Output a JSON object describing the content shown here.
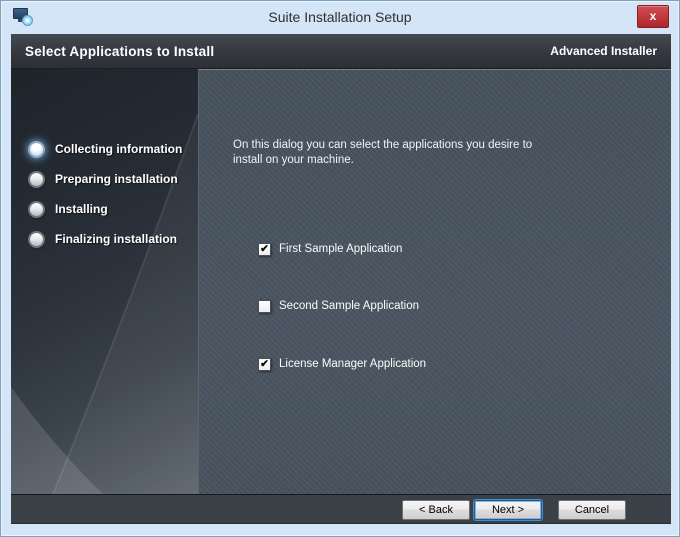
{
  "window": {
    "title": "Suite Installation Setup"
  },
  "icons": {
    "app": "installer-monitor-disc",
    "close": "x",
    "check": "✔"
  },
  "header": {
    "title": "Select Applications to Install",
    "brand": "Advanced Installer"
  },
  "sidebar": {
    "steps": [
      {
        "label": "Collecting information",
        "active": true
      },
      {
        "label": "Preparing installation",
        "active": false
      },
      {
        "label": "Installing",
        "active": false
      },
      {
        "label": "Finalizing installation",
        "active": false
      }
    ]
  },
  "main": {
    "description_lines": [
      "On this dialog you can select the applications you desire to",
      "install on your machine."
    ],
    "checkboxes": [
      {
        "label": "First Sample Application",
        "checked": true
      },
      {
        "label": "Second Sample Application",
        "checked": false
      },
      {
        "label": "License Manager Application",
        "checked": true
      }
    ]
  },
  "footer": {
    "buttons": [
      {
        "label": "< Back",
        "focused": false
      },
      {
        "label": "Next >",
        "focused": true
      },
      {
        "label": "Cancel",
        "focused": false
      }
    ]
  },
  "colors": {
    "frame_blue": "#d3e5f6",
    "header_bg": "#33373d",
    "content_bg": "#49545f",
    "sidebar_dark": "#262c34",
    "footer_bg": "#3b4046",
    "close_red": "#c23b41",
    "focus_blue": "#4b8cc4",
    "active_step_glow": "#78b4eb"
  }
}
